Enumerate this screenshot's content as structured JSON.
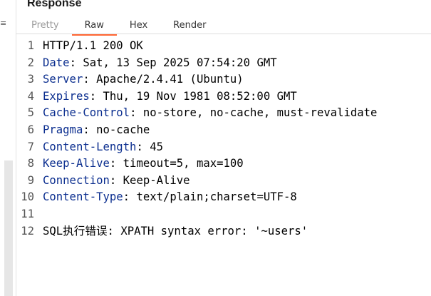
{
  "panel": {
    "title": "Response",
    "left_chevron": "≡"
  },
  "tabs": [
    {
      "label": "Pretty",
      "active": false
    },
    {
      "label": "Raw",
      "active": true
    },
    {
      "label": "Hex",
      "active": false
    },
    {
      "label": "Render",
      "active": false
    }
  ],
  "colors": {
    "accent": "#ff6633",
    "header_name": "#0b2e8f"
  },
  "lines": [
    {
      "num": "1",
      "text": "HTTP/1.1 200 OK"
    },
    {
      "num": "2",
      "name": "Date",
      "sep": ": ",
      "value": "Sat, 13 Sep 2025 07:54:20 GMT"
    },
    {
      "num": "3",
      "name": "Server",
      "sep": ": ",
      "value": "Apache/2.4.41 (Ubuntu)"
    },
    {
      "num": "4",
      "name": "Expires",
      "sep": ": ",
      "value": "Thu, 19 Nov 1981 08:52:00 GMT"
    },
    {
      "num": "5",
      "name": "Cache-Control",
      "sep": ": ",
      "value": "no-store, no-cache, must-revalidate"
    },
    {
      "num": "6",
      "name": "Pragma",
      "sep": ": ",
      "value": "no-cache"
    },
    {
      "num": "7",
      "name": "Content-Length",
      "sep": ": ",
      "value": "45"
    },
    {
      "num": "8",
      "name": "Keep-Alive",
      "sep": ": ",
      "value": "timeout=5, max=100"
    },
    {
      "num": "9",
      "name": "Connection",
      "sep": ": ",
      "value": "Keep-Alive"
    },
    {
      "num": "10",
      "name": "Content-Type",
      "sep": ": ",
      "value": "text/plain;charset=UTF-8"
    },
    {
      "num": "11",
      "text": ""
    },
    {
      "num": "12",
      "text": "SQL执行错误: XPATH syntax error: '~users'"
    }
  ]
}
